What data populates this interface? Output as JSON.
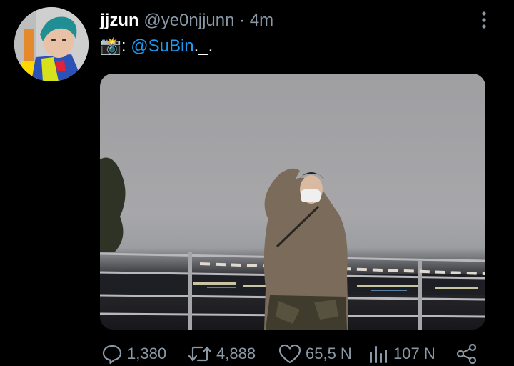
{
  "tweet": {
    "display_name": "jjzun",
    "handle": "@ye0njjunn",
    "separator": "·",
    "time": "4m",
    "camera_emoji": "📸",
    "colon": ":",
    "mention": "@SuBin",
    "trailing": "._."
  },
  "actions": {
    "replies": "1,380",
    "retweets": "4,888",
    "likes": "65,5 N",
    "views": "107 N"
  },
  "icons": {
    "more": "more-vertical-icon",
    "reply": "reply-icon",
    "retweet": "retweet-icon",
    "like": "heart-icon",
    "views": "views-bar-chart-icon",
    "share": "share-icon"
  },
  "colors": {
    "background": "#000000",
    "text": "#ffffff",
    "muted": "#8b98a5",
    "link": "#1d9bf0"
  }
}
